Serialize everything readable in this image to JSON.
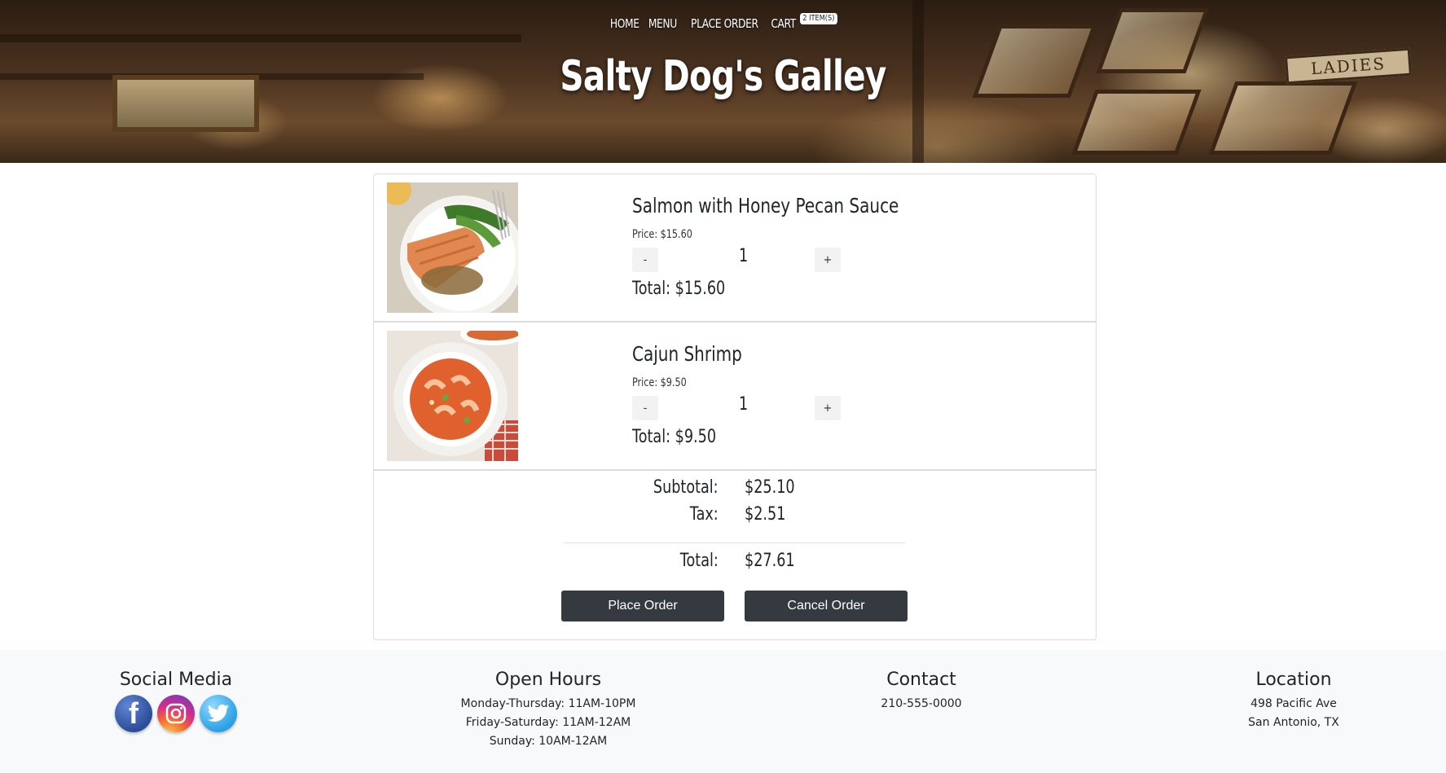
{
  "nav": {
    "home": "HOME",
    "menu": "MENU",
    "place_order": "PLACE ORDER",
    "cart": "CART",
    "cart_badge": "2 ITEM(S)"
  },
  "site_title": "Salty Dog's Galley",
  "header_sign": "LADIES",
  "cart_items": [
    {
      "name": "Salmon with Honey Pecan Sauce",
      "price": "Price: $15.60",
      "minus": "-",
      "qty": "1",
      "plus": "+",
      "total": "Total: $15.60"
    },
    {
      "name": "Cajun Shrimp",
      "price": "Price: $9.50",
      "minus": "-",
      "qty": "1",
      "plus": "+",
      "total": "Total: $9.50"
    }
  ],
  "summary": {
    "subtotal_label": "Subtotal:",
    "subtotal_value": "$25.10",
    "tax_label": "Tax:",
    "tax_value": "$2.51",
    "total_label": "Total:",
    "total_value": "$27.61"
  },
  "actions": {
    "place_order": "Place Order",
    "cancel_order": "Cancel Order"
  },
  "footer": {
    "social_title": "Social Media",
    "social_icons": [
      "facebook-icon",
      "instagram-icon",
      "twitter-icon"
    ],
    "hours_title": "Open Hours",
    "hours": [
      "Monday-Thursday: 11AM-10PM",
      "Friday-Saturday: 11AM-12AM",
      "Sunday: 10AM-12AM"
    ],
    "contact_title": "Contact",
    "phone": "210-555-0000",
    "location_title": "Location",
    "address_line1": "498 Pacific Ave",
    "address_line2": "San Antonio, TX"
  },
  "colors": {
    "button_dark": "#343a40",
    "footer_bg": "#f8f9fa",
    "border": "#dcdcdc",
    "facebook": "#3b5998",
    "twitter": "#2ba0e4"
  }
}
